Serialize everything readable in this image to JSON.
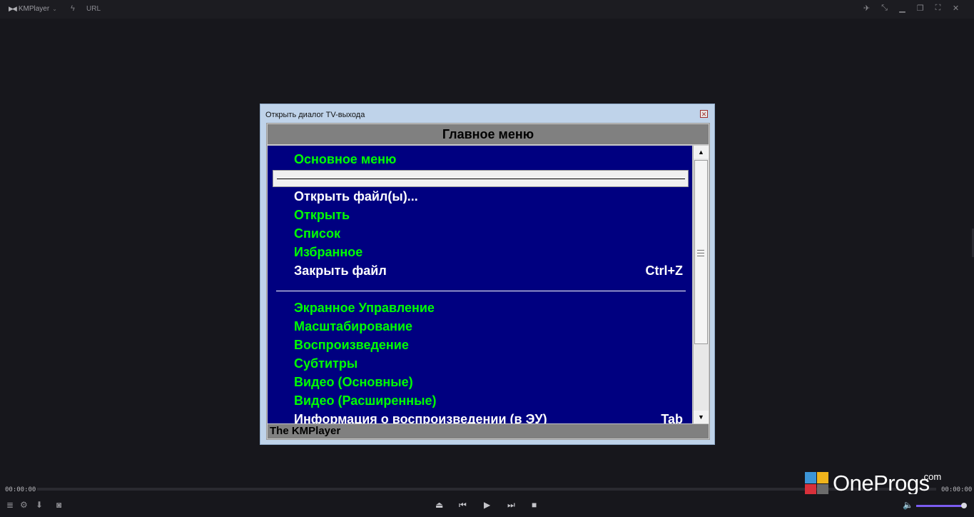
{
  "titlebar": {
    "app_name": "KMPlayer",
    "url_label": "URL"
  },
  "dialog": {
    "title": "Открыть диалог TV-выхода",
    "close_glyph": "✕",
    "header": "Главное меню",
    "footer": "The KMPlayer",
    "items": [
      {
        "label": "Основное меню",
        "color": "green",
        "shortcut": ""
      },
      {
        "label": "Открыть файл(ы)...",
        "color": "white",
        "shortcut": ""
      },
      {
        "label": "Открыть",
        "color": "green",
        "shortcut": ""
      },
      {
        "label": "Список",
        "color": "green",
        "shortcut": ""
      },
      {
        "label": "Избранное",
        "color": "green",
        "shortcut": ""
      },
      {
        "label": "Закрыть файл",
        "color": "white",
        "shortcut": "Ctrl+Z"
      },
      {
        "label": "Экранное Управление",
        "color": "green",
        "shortcut": ""
      },
      {
        "label": "Масштабирование",
        "color": "green",
        "shortcut": ""
      },
      {
        "label": "Воспроизведение",
        "color": "green",
        "shortcut": ""
      },
      {
        "label": "Субтитры",
        "color": "green",
        "shortcut": ""
      },
      {
        "label": "Видео (Основные)",
        "color": "green",
        "shortcut": ""
      },
      {
        "label": "Видео (Расширенные)",
        "color": "green",
        "shortcut": ""
      },
      {
        "label": "Информация о воспроизведении (в ЭУ)",
        "color": "white",
        "shortcut": "Tab"
      }
    ]
  },
  "player": {
    "time_elapsed": "00:00:00",
    "time_total": "00:00:00",
    "volume_fraction": 0.95
  },
  "watermark": {
    "text": "OneProgs",
    "suffix": ".com"
  },
  "colors": {
    "menu_bg": "#000080",
    "menu_green": "#00ff00",
    "menu_white": "#ffffff",
    "header_gray": "#808080",
    "volume_accent": "#7b5cf0"
  },
  "icons": {
    "titlebar": [
      "pin-icon",
      "shrink-icon",
      "minimize-icon",
      "restore-icon",
      "fullscreen-icon",
      "close-icon"
    ],
    "controls": [
      "menu-icon",
      "settings-icon",
      "capture-icon",
      "vr-icon",
      "eject-icon",
      "prev-icon",
      "play-icon",
      "next-icon",
      "stop-icon",
      "volume-icon"
    ]
  }
}
